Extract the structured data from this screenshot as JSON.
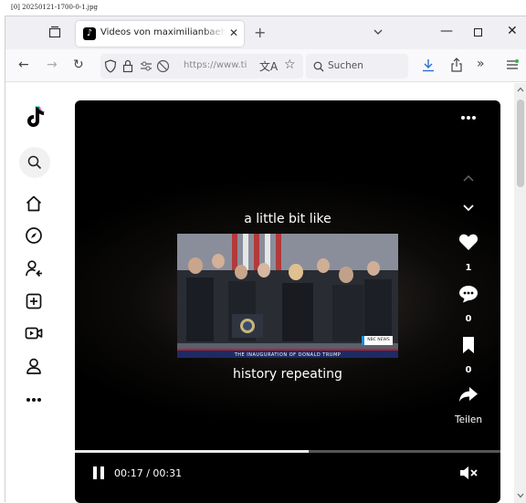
{
  "caption": "[0] 20250121-1700-0-1.jpg",
  "browser": {
    "tab": {
      "title": "Videos von maximilianbaehring",
      "favicon": "tiktok-icon"
    },
    "icons": {
      "tab_list": "tab-list-icon",
      "new_tab": "plus-icon",
      "list_all_tabs": "chevron-down-icon",
      "minimize": "minimize-icon",
      "maximize": "maximize-icon",
      "close": "close-icon",
      "back": "back-arrow-icon",
      "forward": "forward-arrow-icon",
      "reload": "reload-icon",
      "shield": "shield-icon",
      "lock": "lock-icon",
      "permissions": "permissions-icon",
      "tracking": "tracking-protection-icon",
      "translate": "translate-icon",
      "bookmark": "star-icon",
      "downloads": "download-icon",
      "share": "share-icon",
      "overflow": "overflow-icon",
      "menu": "menu-icon"
    },
    "url": "https://www.ti",
    "search_placeholder": "Suchen"
  },
  "sidebar": {
    "items": [
      {
        "name": "tiktok-logo-icon"
      },
      {
        "name": "search-icon"
      },
      {
        "name": "home-icon"
      },
      {
        "name": "explore-icon"
      },
      {
        "name": "following-icon"
      },
      {
        "name": "upload-icon"
      },
      {
        "name": "live-icon"
      },
      {
        "name": "profile-icon"
      },
      {
        "name": "more-icon"
      }
    ]
  },
  "video": {
    "caption_top": "a little bit like",
    "caption_bottom": "history repeating",
    "banner_text": "THE INAUGURATION OF DONALD TRUMP",
    "news_logo": "NBC NEWS",
    "actions": {
      "like_count": "1",
      "comment_count": "0",
      "save_count": "0",
      "share_label": "Teilen"
    },
    "time_current": "00:17",
    "time_total": "00:31",
    "time_display": "00:17 / 00:31",
    "progress": 0.55,
    "colors": {
      "background": "#000000",
      "foreground": "#ffffff"
    }
  },
  "colors": {
    "tab_strip": "#f0f0f4",
    "nav_bar": "#f9f9fb",
    "url_field": "#f0f0f4"
  }
}
